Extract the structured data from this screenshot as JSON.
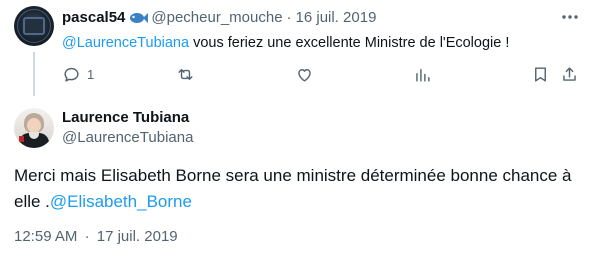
{
  "reply": {
    "display_name": "pascal54",
    "name_emoji": "fish-icon",
    "handle": "@pecheur_mouche",
    "separator": "·",
    "date": "16 juil. 2019",
    "mention": "@LaurenceTubiana",
    "text": " vous feriez une excellente Ministre de l'Ecologie !",
    "reply_count": "1"
  },
  "tweet": {
    "display_name": "Laurence Tubiana",
    "handle": "@LaurenceTubiana",
    "text": "Merci mais Elisabeth Borne sera une ministre déterminée bonne chance à elle .",
    "mention": "@Elisabeth_Borne",
    "time": "12:59 AM",
    "separator": "·",
    "date": "17 juil. 2019"
  },
  "colors": {
    "accent": "#1d9bf0",
    "secondary_text": "#536471",
    "primary_text": "#0f1419",
    "thread_line": "#cfd9de"
  }
}
